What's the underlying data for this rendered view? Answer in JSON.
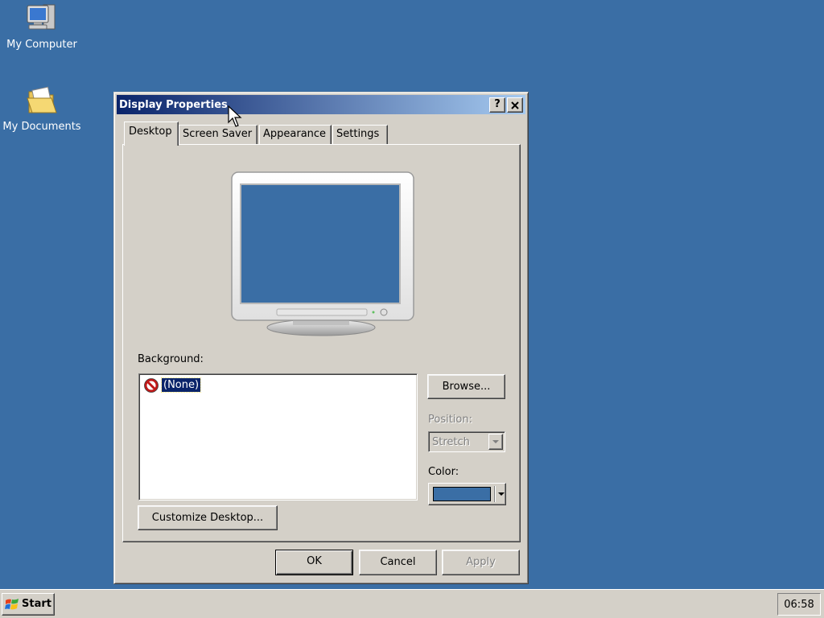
{
  "desktop": {
    "background_color": "#3a6ea5",
    "icons": [
      {
        "label": "My Computer",
        "icon": "computer-icon"
      },
      {
        "label": "My Documents",
        "icon": "folder-documents-icon"
      }
    ]
  },
  "window": {
    "title": "Display Properties",
    "help_label": "?",
    "close_label": "✕",
    "tabs": [
      {
        "label": "Desktop",
        "active": true
      },
      {
        "label": "Screen Saver",
        "active": false
      },
      {
        "label": "Appearance",
        "active": false
      },
      {
        "label": "Settings",
        "active": false
      }
    ],
    "desktop_tab": {
      "background_label": "Background:",
      "background_items": [
        {
          "label": "(None)",
          "icon": "none-icon",
          "selected": true
        }
      ],
      "browse_label": "Browse...",
      "position_label": "Position:",
      "position_value": "Stretch",
      "position_enabled": false,
      "color_label": "Color:",
      "color_value": "#3a6ea5",
      "customize_label": "Customize Desktop..."
    },
    "buttons": {
      "ok": "OK",
      "cancel": "Cancel",
      "apply": "Apply",
      "apply_enabled": false
    }
  },
  "taskbar": {
    "start_label": "Start",
    "clock": "06:58"
  }
}
